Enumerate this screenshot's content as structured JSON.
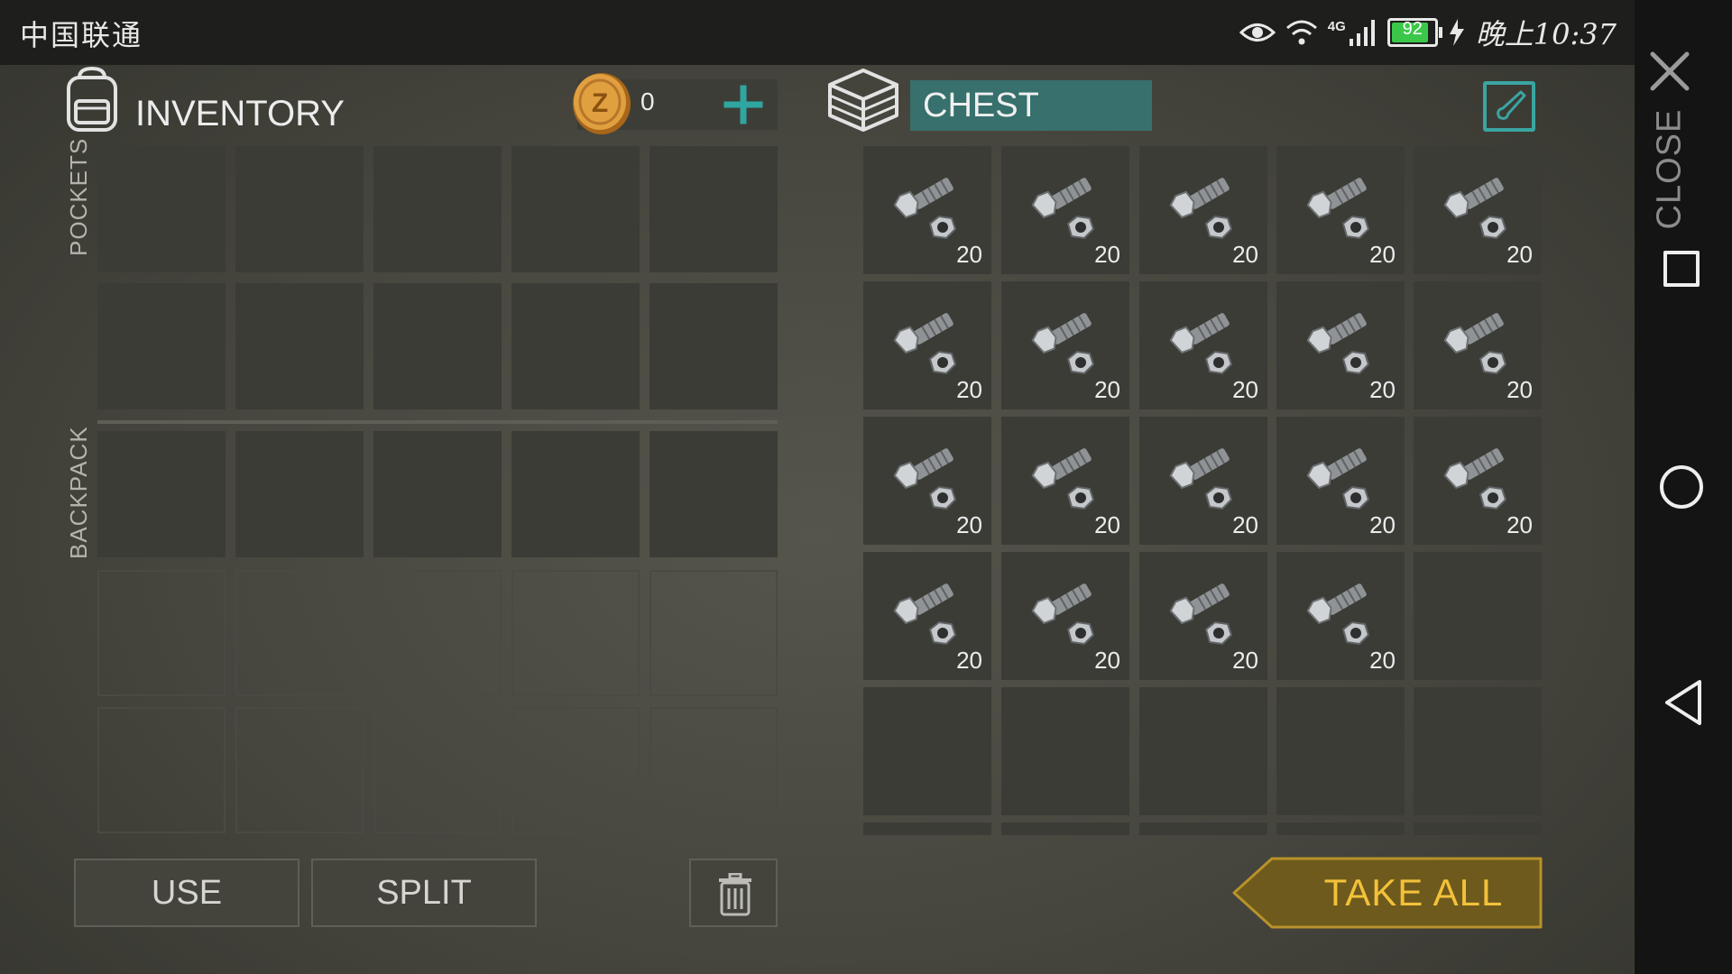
{
  "status_bar": {
    "carrier": "中国联通",
    "network": "4G",
    "battery_percent": "92",
    "time": "晚上10:37"
  },
  "nav": {
    "close_label": "CLOSE"
  },
  "inventory": {
    "title": "INVENTORY",
    "coins": "0",
    "pockets_label": "POCKETS",
    "backpack_label": "BACKPACK",
    "use_label": "USE",
    "split_label": "SPLIT"
  },
  "chest": {
    "title": "CHEST",
    "take_all_label": "TAKE ALL",
    "item_name": "bolt-and-nut-icon",
    "slots": [
      {
        "qty": "20"
      },
      {
        "qty": "20"
      },
      {
        "qty": "20"
      },
      {
        "qty": "20"
      },
      {
        "qty": "20"
      },
      {
        "qty": "20"
      },
      {
        "qty": "20"
      },
      {
        "qty": "20"
      },
      {
        "qty": "20"
      },
      {
        "qty": "20"
      },
      {
        "qty": "20"
      },
      {
        "qty": "20"
      },
      {
        "qty": "20"
      },
      {
        "qty": "20"
      },
      {
        "qty": "20"
      },
      {
        "qty": "20"
      },
      {
        "qty": "20"
      },
      {
        "qty": "20"
      },
      {
        "qty": "20"
      },
      {
        "qty": ""
      },
      {
        "qty": ""
      },
      {
        "qty": ""
      },
      {
        "qty": ""
      },
      {
        "qty": ""
      },
      {
        "qty": ""
      }
    ]
  },
  "colors": {
    "accent_teal": "#37706c",
    "take_all_gold": "#f3c13a",
    "battery_green": "#3bc84a"
  }
}
